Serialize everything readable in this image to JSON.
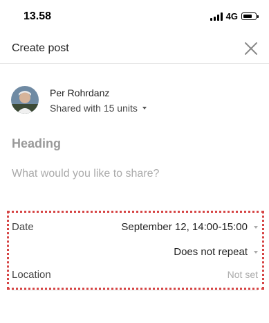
{
  "status_bar": {
    "time": "13.58",
    "network": "4G"
  },
  "header": {
    "title": "Create post"
  },
  "author": {
    "name": "Per Rohrdanz",
    "audience": "Shared with 15 units"
  },
  "compose": {
    "heading_placeholder": "Heading",
    "body_placeholder": "What would you like to share?"
  },
  "details": {
    "date_label": "Date",
    "date_value": "September 12, 14:00-15:00",
    "repeat_value": "Does not repeat",
    "location_label": "Location",
    "location_value": "Not set"
  }
}
